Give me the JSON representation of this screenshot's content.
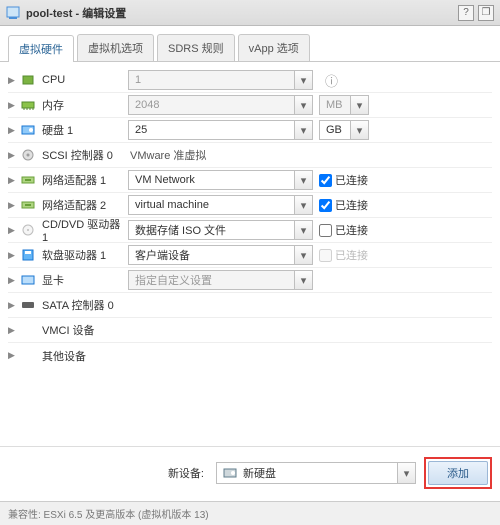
{
  "title": "pool-test - 编辑设置",
  "tabs": {
    "hardware": "虚拟硬件",
    "vmoptions": "虚拟机选项",
    "sdrs": "SDRS 规则",
    "vapp": "vApp 选项"
  },
  "rows": {
    "cpu": {
      "label": "CPU",
      "value": "1"
    },
    "memory": {
      "label": "内存",
      "value": "2048",
      "unit": "MB"
    },
    "disk": {
      "label": "硬盘 1",
      "value": "25",
      "unit": "GB"
    },
    "scsi": {
      "label": "SCSI 控制器 0",
      "value": "VMware 准虚拟"
    },
    "nic1": {
      "label": "网络适配器 1",
      "value": "VM Network",
      "connected": "已连接"
    },
    "nic2": {
      "label": "网络适配器 2",
      "value": "virtual machine",
      "connected": "已连接"
    },
    "cdrom": {
      "label": "CD/DVD 驱动器 1",
      "value": "数据存储 ISO 文件",
      "connected": "已连接"
    },
    "floppy": {
      "label": "软盘驱动器 1",
      "value": "客户端设备",
      "connected": "已连接"
    },
    "video": {
      "label": "显卡",
      "value": "指定自定义设置"
    },
    "sata": {
      "label": "SATA 控制器 0"
    },
    "vmci": {
      "label": "VMCI 设备"
    },
    "other": {
      "label": "其他设备"
    }
  },
  "bottom": {
    "label": "新设备:",
    "device": "新硬盘",
    "add": "添加"
  },
  "footer": "兼容性: ESXi 6.5 及更高版本 (虚拟机版本 13)"
}
